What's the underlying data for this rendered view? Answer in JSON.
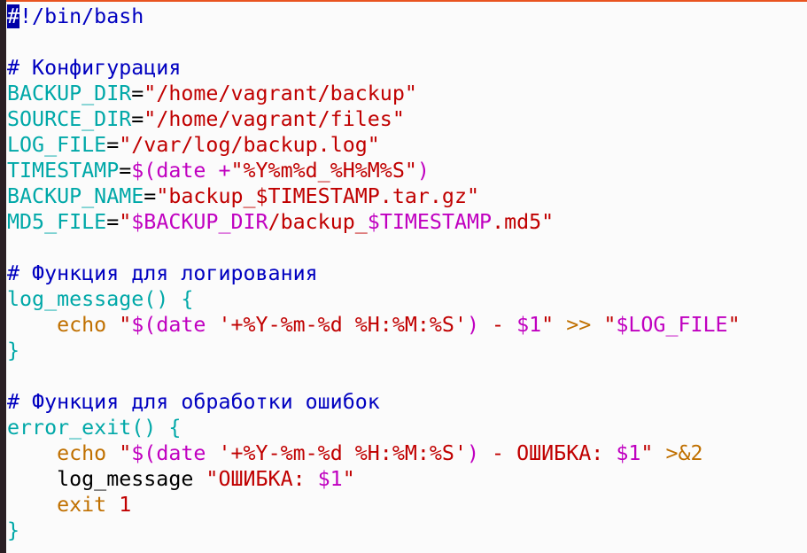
{
  "colors": {
    "comment": "#0000c0",
    "ident": "#00a8a8",
    "string": "#c00000",
    "subst": "#c000c0",
    "keyword": "#c07000",
    "plain": "#000000",
    "cursor_bg": "#0000a8"
  },
  "editor": {
    "cursor_line": 0,
    "lines": [
      [
        [
          "#",
          "comment"
        ],
        [
          "!/bin/bash",
          "comment"
        ]
      ],
      [],
      [
        [
          "# Конфигурация",
          "comment"
        ]
      ],
      [
        [
          "BACKUP_DIR",
          "ident"
        ],
        [
          "=",
          "plain"
        ],
        [
          "\"/home/vagrant/backup\"",
          "string"
        ]
      ],
      [
        [
          "SOURCE_DIR",
          "ident"
        ],
        [
          "=",
          "plain"
        ],
        [
          "\"/home/vagrant/files\"",
          "string"
        ]
      ],
      [
        [
          "LOG_FILE",
          "ident"
        ],
        [
          "=",
          "plain"
        ],
        [
          "\"/var/log/backup.log\"",
          "string"
        ]
      ],
      [
        [
          "TIMESTAMP",
          "ident"
        ],
        [
          "=",
          "plain"
        ],
        [
          "$(date +",
          "subst"
        ],
        [
          "\"%Y%m%d_%H%M%S\"",
          "string"
        ],
        [
          ")",
          "subst"
        ]
      ],
      [
        [
          "BACKUP_NAME",
          "ident"
        ],
        [
          "=",
          "plain"
        ],
        [
          "\"backup_$TIMESTAMP.tar.gz\"",
          "string"
        ]
      ],
      [
        [
          "MD5_FILE",
          "ident"
        ],
        [
          "=",
          "plain"
        ],
        [
          "\"",
          "string"
        ],
        [
          "$BACKUP_DIR",
          "subst"
        ],
        [
          "/backup_",
          "string"
        ],
        [
          "$TIMESTAMP",
          "subst"
        ],
        [
          ".md5\"",
          "string"
        ]
      ],
      [],
      [
        [
          "# Функция для логирования",
          "comment"
        ]
      ],
      [
        [
          "log_message() {",
          "ident"
        ]
      ],
      [
        [
          "    ",
          "plain"
        ],
        [
          "echo",
          "keyword"
        ],
        [
          " \"",
          "string"
        ],
        [
          "$(date ",
          "subst"
        ],
        [
          "'+%Y-%m-%d %H:%M:%S'",
          "string"
        ],
        [
          ")",
          "subst"
        ],
        [
          " - ",
          "string"
        ],
        [
          "$1",
          "subst"
        ],
        [
          "\"",
          "string"
        ],
        [
          " >> ",
          "keyword"
        ],
        [
          "\"",
          "string"
        ],
        [
          "$LOG_FILE",
          "subst"
        ],
        [
          "\"",
          "string"
        ]
      ],
      [
        [
          "}",
          "ident"
        ]
      ],
      [],
      [
        [
          "# Функция для обработки ошибок",
          "comment"
        ]
      ],
      [
        [
          "error_exit() {",
          "ident"
        ]
      ],
      [
        [
          "    ",
          "plain"
        ],
        [
          "echo",
          "keyword"
        ],
        [
          " \"",
          "string"
        ],
        [
          "$(date ",
          "subst"
        ],
        [
          "'+%Y-%m-%d %H:%M:%S'",
          "string"
        ],
        [
          ")",
          "subst"
        ],
        [
          " - ОШИБКА: ",
          "string"
        ],
        [
          "$1",
          "subst"
        ],
        [
          "\"",
          "string"
        ],
        [
          " >&2",
          "keyword"
        ]
      ],
      [
        [
          "    log_message ",
          "plain"
        ],
        [
          "\"ОШИБКА: ",
          "string"
        ],
        [
          "$1",
          "subst"
        ],
        [
          "\"",
          "string"
        ]
      ],
      [
        [
          "    ",
          "plain"
        ],
        [
          "exit",
          "keyword"
        ],
        [
          " 1",
          "string"
        ]
      ],
      [
        [
          "}",
          "ident"
        ]
      ]
    ]
  }
}
